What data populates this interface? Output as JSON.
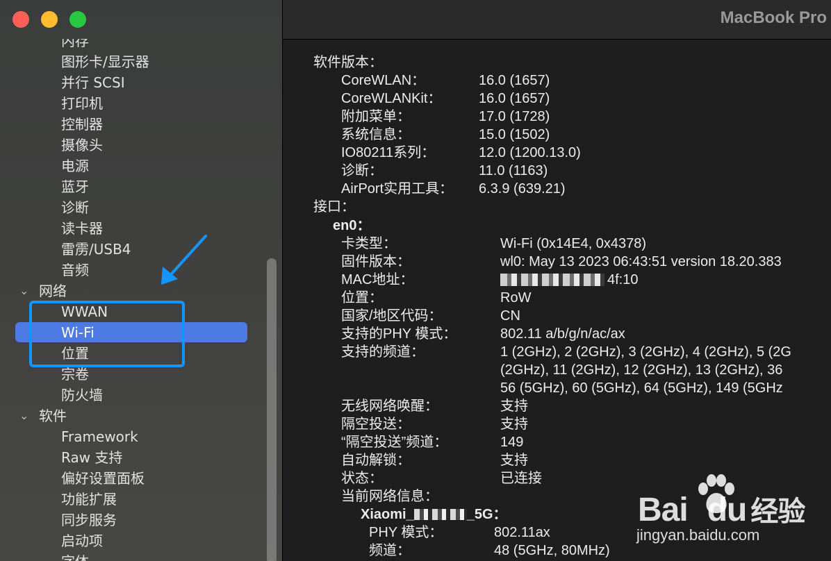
{
  "window": {
    "title": "MacBook Pro"
  },
  "sidebar": {
    "items": [
      {
        "label": "内存",
        "level": 2
      },
      {
        "label": "图形卡/显示器",
        "level": 2
      },
      {
        "label": "并行 SCSI",
        "level": 2
      },
      {
        "label": "打印机",
        "level": 2
      },
      {
        "label": "控制器",
        "level": 2
      },
      {
        "label": "摄像头",
        "level": 2
      },
      {
        "label": "电源",
        "level": 2
      },
      {
        "label": "蓝牙",
        "level": 2
      },
      {
        "label": "诊断",
        "level": 2
      },
      {
        "label": "读卡器",
        "level": 2
      },
      {
        "label": "雷雳/USB4",
        "level": 2
      },
      {
        "label": "音频",
        "level": 2
      },
      {
        "label": "网络",
        "level": 1
      },
      {
        "label": "WWAN",
        "level": 2
      },
      {
        "label": "Wi-Fi",
        "level": 2
      },
      {
        "label": "位置",
        "level": 2
      },
      {
        "label": "宗卷",
        "level": 2
      },
      {
        "label": "防火墙",
        "level": 2
      },
      {
        "label": "软件",
        "level": 1
      },
      {
        "label": "Framework",
        "level": 2
      },
      {
        "label": "Raw 支持",
        "level": 2
      },
      {
        "label": "偏好设置面板",
        "level": 2
      },
      {
        "label": "功能扩展",
        "level": 2
      },
      {
        "label": "同步服务",
        "level": 2
      },
      {
        "label": "启动项",
        "level": 2
      },
      {
        "label": "字体",
        "level": 2
      }
    ],
    "selected": "Wi-Fi"
  },
  "details": {
    "software_header": "软件版本：",
    "software": [
      {
        "k": "CoreWLAN：",
        "v": "16.0 (1657)"
      },
      {
        "k": "CoreWLANKit：",
        "v": "16.0 (1657)"
      },
      {
        "k": "附加菜单：",
        "v": "17.0 (1728)"
      },
      {
        "k": "系统信息：",
        "v": "15.0 (1502)"
      },
      {
        "k": "IO80211系列：",
        "v": "12.0 (1200.13.0)"
      },
      {
        "k": "诊断：",
        "v": "11.0 (1163)"
      },
      {
        "k": "AirPort实用工具：",
        "v": "6.3.9 (639.21)"
      }
    ],
    "interfaces_header": "接口：",
    "iface_name": "en0：",
    "iface": [
      {
        "k": "卡类型：",
        "v": "Wi-Fi  (0x14E4, 0x4378)"
      },
      {
        "k": "固件版本：",
        "v": "wl0: May 13 2023 06:43:51 version 18.20.383"
      },
      {
        "k": "MAC地址：",
        "v": "4f:10"
      },
      {
        "k": "位置：",
        "v": "RoW"
      },
      {
        "k": "国家/地区代码：",
        "v": "CN"
      },
      {
        "k": "支持的PHY 模式：",
        "v": "802.11 a/b/g/n/ac/ax"
      },
      {
        "k": "支持的频道：",
        "v": "1 (2GHz), 2 (2GHz), 3 (2GHz), 4 (2GHz), 5 (2G"
      },
      {
        "k": "",
        "v": "(2GHz), 11 (2GHz), 12 (2GHz), 13 (2GHz), 36"
      },
      {
        "k": "",
        "v": "56 (5GHz), 60 (5GHz), 64 (5GHz), 149 (5GHz"
      },
      {
        "k": "无线网络唤醒：",
        "v": "支持"
      },
      {
        "k": "隔空投送：",
        "v": "支持"
      },
      {
        "k": "“隔空投送”频道：",
        "v": "149"
      },
      {
        "k": "自动解锁：",
        "v": "支持"
      },
      {
        "k": "状态：",
        "v": "已连接"
      },
      {
        "k": "当前网络信息：",
        "v": ""
      }
    ],
    "network_name": "Xiaomi_",
    "network_suffix": "_5G：",
    "network": [
      {
        "k": "PHY 模式：",
        "v": "802.11ax"
      },
      {
        "k": "频道：",
        "v": "48 (5GHz, 80MHz)"
      }
    ]
  },
  "watermark": {
    "brand": "Bai",
    "brand2": "du",
    "cn": "经验",
    "url": "jingyan.baidu.com"
  }
}
